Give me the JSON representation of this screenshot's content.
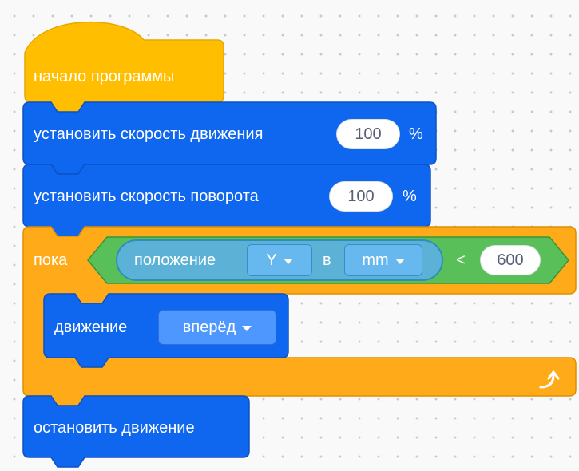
{
  "program": {
    "start_label": "начало программы",
    "set_move_speed": {
      "label": "установить скорость движения",
      "value": "100",
      "unit": "%"
    },
    "set_turn_speed": {
      "label": "установить скорость поворота",
      "value": "100",
      "unit": "%"
    },
    "while_loop": {
      "label": "пока",
      "condition": {
        "sensor_label": "положение",
        "axis_value": "Y",
        "in_label": "в",
        "unit_value": "mm",
        "operator": "<",
        "compare_value": "600"
      },
      "body": {
        "label": "движение",
        "direction_value": "вперёд"
      }
    },
    "stop_label": "остановить движение"
  },
  "colors": {
    "events_yellow": "#ffbf00",
    "motion_blue": "#0f66ef",
    "control_orange": "#ffab19",
    "operator_green": "#59c059",
    "sensing_light_blue": "#5cb1d6",
    "workspace": "#f9f9f9"
  },
  "icons": {
    "loop_end": "loop-arrow-icon"
  }
}
